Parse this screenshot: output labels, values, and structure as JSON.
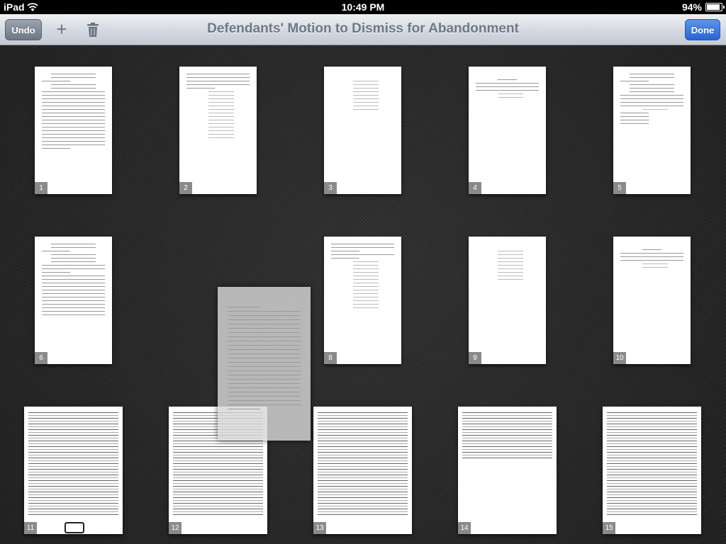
{
  "status_bar": {
    "device": "iPad",
    "time": "10:49 PM",
    "battery": "94%",
    "battery_level": 0.94
  },
  "toolbar": {
    "undo_label": "Undo",
    "add_label": "+",
    "trash_icon": "trash-icon",
    "title": "Defendants' Motion to Dismiss for Abandonment",
    "done_label": "Done"
  },
  "pages": [
    {
      "number": "1"
    },
    {
      "number": "2"
    },
    {
      "number": "3"
    },
    {
      "number": "4"
    },
    {
      "number": "5"
    },
    {
      "number": "6"
    },
    {
      "number": "8"
    },
    {
      "number": "9"
    },
    {
      "number": "10"
    },
    {
      "number": "11"
    },
    {
      "number": "12"
    },
    {
      "number": "13"
    },
    {
      "number": "14"
    },
    {
      "number": "15"
    }
  ]
}
